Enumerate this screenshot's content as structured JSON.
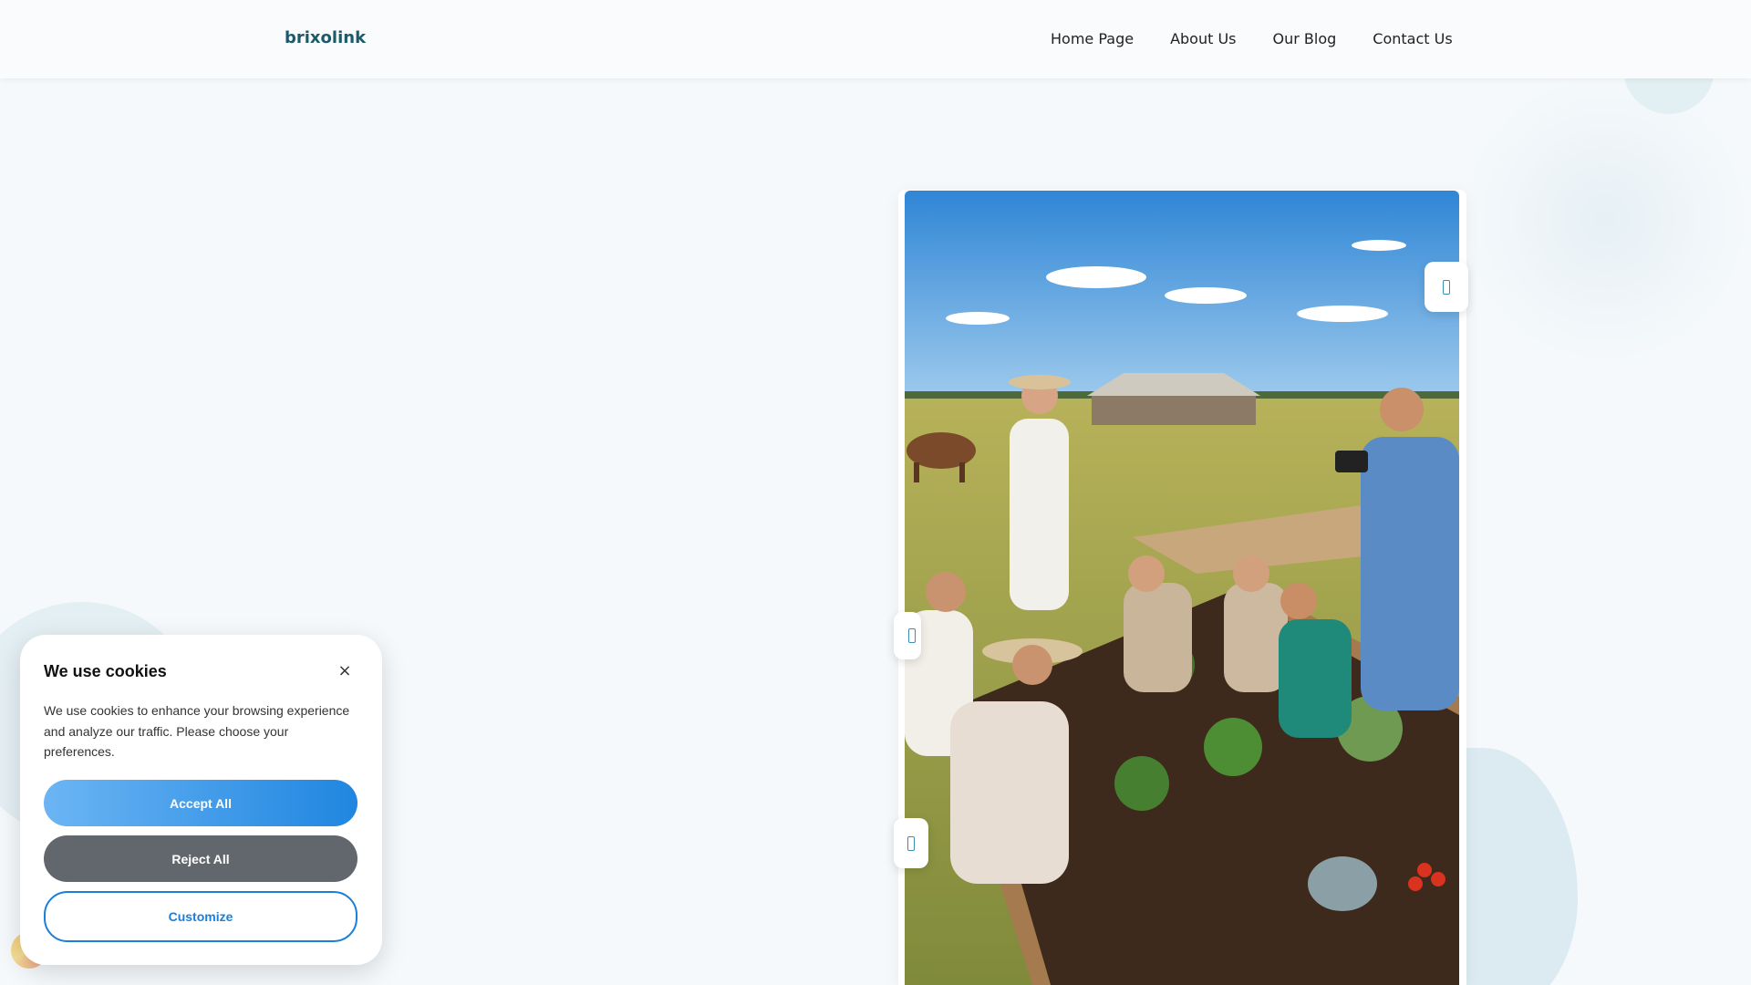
{
  "header": {
    "logo": "brixolink",
    "nav": [
      {
        "label": "Home Page"
      },
      {
        "label": "About Us"
      },
      {
        "label": "Our Blog"
      },
      {
        "label": "Contact Us"
      }
    ]
  },
  "hero": {
    "image_icon": "community-garden-photo"
  },
  "cookie": {
    "title": "We use cookies",
    "close_label": "×",
    "text": "We use cookies to enhance your browsing experience and analyze our traffic. Please choose your preferences.",
    "accept_label": "Accept All",
    "reject_label": "Reject All",
    "customize_label": "Customize"
  },
  "colors": {
    "brand": "#1c5a6a",
    "accept": "#1f86e0",
    "reject": "#62676d",
    "customize": "#1a7fd8"
  }
}
